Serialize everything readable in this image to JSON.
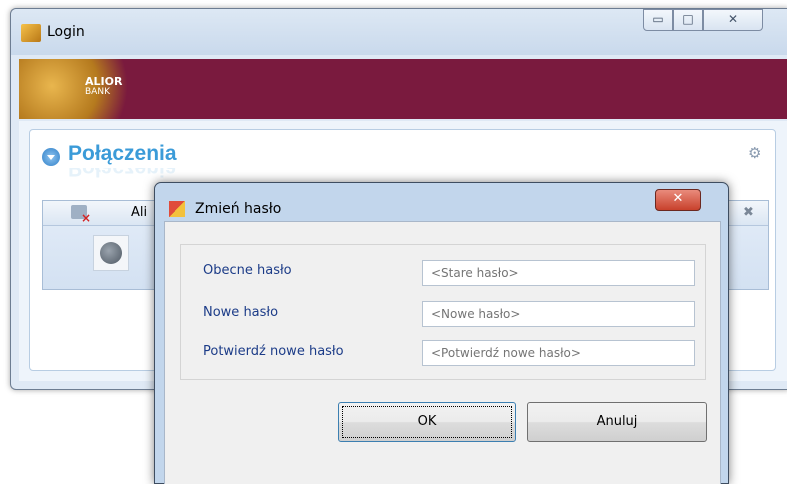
{
  "window": {
    "title": "Login"
  },
  "banner": {
    "logo_line1": "ALIOR",
    "logo_line2": "BANK"
  },
  "section": {
    "title": "Połączenia"
  },
  "connection": {
    "name": "Ali"
  },
  "dialog": {
    "title": "Zmień hasło",
    "fields": [
      {
        "label": "Obecne hasło",
        "placeholder": "<Stare hasło>"
      },
      {
        "label": "Nowe hasło",
        "placeholder": "<Nowe hasło>"
      },
      {
        "label": "Potwierdź nowe hasło",
        "placeholder": "<Potwierdź nowe hasło>"
      }
    ],
    "ok_label": "OK",
    "cancel_label": "Anuluj"
  },
  "icons": [
    "app-icon",
    "minimize-icon",
    "maximize-icon",
    "close-icon",
    "settings-gear-icon",
    "disconnected-icon",
    "globe-icon",
    "dialog-app-icon",
    "dialog-close-icon"
  ],
  "colors": {
    "banner": "#7a1a3e",
    "section_title": "#3b9bd8",
    "label": "#1c3c88",
    "dialog_frame": "#c2d6ec"
  }
}
